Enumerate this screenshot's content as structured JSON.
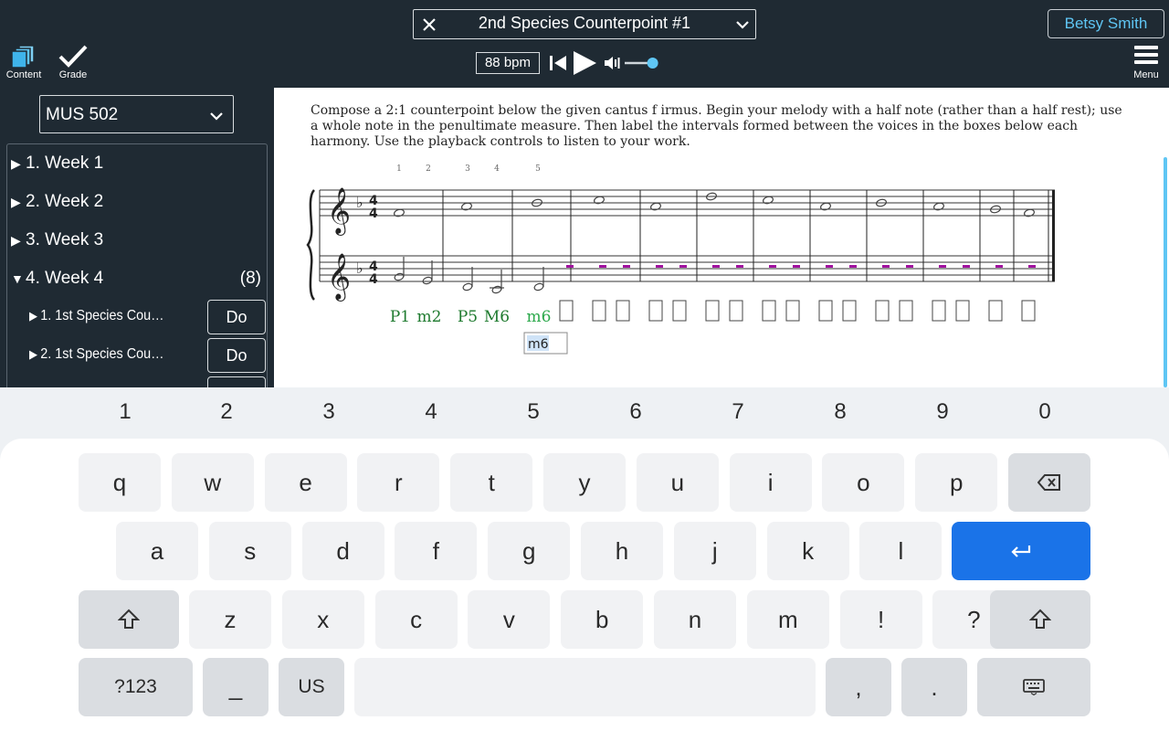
{
  "header": {
    "title": "2nd Species Counterpoint #1",
    "user": "Betsy Smith",
    "content_label": "Content",
    "grade_label": "Grade",
    "menu_label": "Menu",
    "tempo": "88 bpm",
    "volume_level": 0.85
  },
  "sidebar": {
    "course": "MUS 502",
    "weeks": [
      {
        "label": "1. Week 1",
        "expanded": false
      },
      {
        "label": "2. Week 2",
        "expanded": false
      },
      {
        "label": "3. Week 3",
        "expanded": false
      },
      {
        "label": "4. Week 4",
        "expanded": true,
        "count": "(8)"
      }
    ],
    "lessons": [
      {
        "label": "1. 1st Species Counterpoint",
        "action": "Do"
      },
      {
        "label": "2. 1st Species Counterpoint",
        "action": "Do"
      }
    ]
  },
  "main": {
    "instructions": "Compose a 2:1 counterpoint below the given cantus f irmus. Begin your melody with a half note (rather than a half rest); use a whole note in the penultimate measure. Then label the intervals formed between the voices in the boxes below each harmony. Use the playback controls to listen to your work.",
    "note_numbers": [
      "1",
      "2",
      "3",
      "4",
      "5"
    ],
    "intervals": [
      "P1",
      "m2",
      "P5",
      "M6",
      "m6"
    ],
    "input_value": "m6",
    "colors": {
      "interval": "#1e7a2e",
      "interval_active": "#2aa84a",
      "placeholder": "#a0109e",
      "input_highlight": "#cfe3f7"
    }
  },
  "keyboard": {
    "numbers": [
      "1",
      "2",
      "3",
      "4",
      "5",
      "6",
      "7",
      "8",
      "9",
      "0"
    ],
    "row1": [
      "q",
      "w",
      "e",
      "r",
      "t",
      "y",
      "u",
      "i",
      "o",
      "p"
    ],
    "row2": [
      "a",
      "s",
      "d",
      "f",
      "g",
      "h",
      "j",
      "k",
      "l"
    ],
    "row3": [
      "z",
      "x",
      "c",
      "v",
      "b",
      "n",
      "m",
      "!",
      "?"
    ],
    "symbols_label": "?123",
    "underscore": "_",
    "lang": "US",
    "comma": ",",
    "period": ".",
    "accent_color": "#1a73e8"
  }
}
